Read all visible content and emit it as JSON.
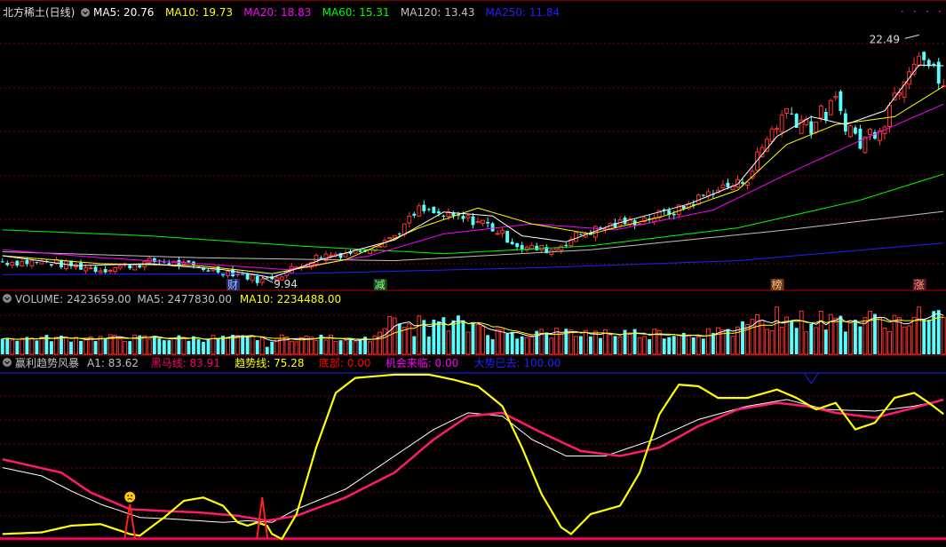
{
  "colors": {
    "bg": "#000000",
    "grid": "#7f0000",
    "up": "#ff3232",
    "down": "#54ffff",
    "ma5": "#ffffff",
    "ma10": "#ffff00",
    "ma20": "#ff00ff",
    "ma60": "#00ff00",
    "ma120": "#c0c0c0",
    "ma250": "#2020ff",
    "label": "#c0c0c0"
  },
  "price_panel": {
    "stock_name": "北方稀土",
    "period": "(日线)",
    "legend": [
      {
        "label": "MA5: 20.76",
        "color": "#ffffff"
      },
      {
        "label": "MA10: 19.73",
        "color": "#ffff00"
      },
      {
        "label": "MA20: 18.83",
        "color": "#ff00ff"
      },
      {
        "label": "MA60: 15.31",
        "color": "#00ff00"
      },
      {
        "label": "MA120: 13.43",
        "color": "#c0c0c0"
      },
      {
        "label": "MA250: 11.84",
        "color": "#2020ff"
      }
    ],
    "high_label": "22.49",
    "low_label": "9.94",
    "markers": [
      {
        "text": "财",
        "idx": 47
      },
      {
        "text": "减",
        "idx": 77
      },
      {
        "text": "榜",
        "idx": 158
      },
      {
        "text": "涨",
        "idx": 187
      }
    ]
  },
  "volume_panel": {
    "legend": [
      {
        "label": "VOLUME: 2423659.00",
        "color": "#c0c0c0"
      },
      {
        "label": "MA5: 2477830.00",
        "color": "#c0c0c0"
      },
      {
        "label": "MA10: 2234488.00",
        "color": "#ffff00"
      }
    ]
  },
  "indicator_panel": {
    "legend": [
      {
        "label": "赢利趋势风暴",
        "color": "#c0c0c0"
      },
      {
        "label": "A1: 83.62",
        "color": "#c0c0c0"
      },
      {
        "label": "黑马线: 83.91",
        "color": "#ff0064"
      },
      {
        "label": "趋势线: 75.28",
        "color": "#ffff00"
      },
      {
        "label": "底部: 0.00",
        "color": "#ff0000"
      },
      {
        "label": "机会来临: 0.00",
        "color": "#ff00ff"
      },
      {
        "label": "大势已去: 100.00",
        "color": "#2020ff"
      }
    ]
  },
  "chart_data": {
    "type": "candlestick",
    "y_range": [
      9.5,
      23.0
    ],
    "keypoints_close": [
      [
        0,
        10.9
      ],
      [
        10,
        10.85
      ],
      [
        20,
        10.5
      ],
      [
        32,
        10.95
      ],
      [
        40,
        10.6
      ],
      [
        48,
        10.3
      ],
      [
        53,
        9.94
      ],
      [
        58,
        10.4
      ],
      [
        65,
        11.2
      ],
      [
        72,
        11.4
      ],
      [
        80,
        12.2
      ],
      [
        85,
        13.5
      ],
      [
        90,
        13.2
      ],
      [
        98,
        12.9
      ],
      [
        106,
        11.6
      ],
      [
        112,
        11.5
      ],
      [
        118,
        12.3
      ],
      [
        124,
        12.7
      ],
      [
        130,
        13.0
      ],
      [
        138,
        13.5
      ],
      [
        145,
        14.5
      ],
      [
        150,
        14.8
      ],
      [
        153,
        15.6
      ],
      [
        157,
        17.6
      ],
      [
        160,
        18.5
      ],
      [
        165,
        17.8
      ],
      [
        170,
        18.8
      ],
      [
        175,
        16.8
      ],
      [
        180,
        18.2
      ],
      [
        184,
        20.5
      ],
      [
        187,
        21.8
      ],
      [
        190,
        20.3
      ],
      [
        192,
        19.8
      ]
    ],
    "keypoints_ma5": [
      [
        0,
        11.2
      ],
      [
        15,
        10.7
      ],
      [
        30,
        10.8
      ],
      [
        45,
        10.5
      ],
      [
        55,
        10.1
      ],
      [
        65,
        11.0
      ],
      [
        80,
        12.0
      ],
      [
        90,
        13.4
      ],
      [
        100,
        13.2
      ],
      [
        106,
        12.2
      ],
      [
        115,
        11.9
      ],
      [
        125,
        12.8
      ],
      [
        140,
        13.8
      ],
      [
        150,
        14.8
      ],
      [
        158,
        17.2
      ],
      [
        165,
        18.2
      ],
      [
        172,
        17.8
      ],
      [
        180,
        18.5
      ],
      [
        187,
        20.8
      ],
      [
        192,
        20.76
      ]
    ],
    "keypoints_ma10": [
      [
        0,
        11.2
      ],
      [
        20,
        10.8
      ],
      [
        40,
        10.7
      ],
      [
        55,
        10.3
      ],
      [
        70,
        11.0
      ],
      [
        85,
        12.6
      ],
      [
        97,
        13.6
      ],
      [
        108,
        12.8
      ],
      [
        120,
        12.3
      ],
      [
        135,
        13.2
      ],
      [
        150,
        14.5
      ],
      [
        160,
        16.8
      ],
      [
        170,
        17.8
      ],
      [
        182,
        18.2
      ],
      [
        192,
        19.73
      ]
    ],
    "keypoints_ma20": [
      [
        0,
        11.5
      ],
      [
        20,
        11.1
      ],
      [
        40,
        10.8
      ],
      [
        58,
        10.5
      ],
      [
        75,
        11.2
      ],
      [
        90,
        12.3
      ],
      [
        108,
        12.8
      ],
      [
        125,
        12.5
      ],
      [
        145,
        13.5
      ],
      [
        160,
        15.3
      ],
      [
        175,
        17.0
      ],
      [
        192,
        18.83
      ]
    ],
    "keypoints_ma60": [
      [
        0,
        12.5
      ],
      [
        30,
        12.2
      ],
      [
        60,
        11.7
      ],
      [
        90,
        11.3
      ],
      [
        120,
        11.7
      ],
      [
        150,
        12.6
      ],
      [
        175,
        14.0
      ],
      [
        192,
        15.31
      ]
    ],
    "keypoints_ma120": [
      [
        0,
        11.4
      ],
      [
        40,
        11.1
      ],
      [
        80,
        10.95
      ],
      [
        120,
        11.5
      ],
      [
        160,
        12.5
      ],
      [
        192,
        13.43
      ]
    ],
    "keypoints_ma250": [
      [
        0,
        10.25
      ],
      [
        60,
        10.3
      ],
      [
        110,
        10.6
      ],
      [
        150,
        10.95
      ],
      [
        192,
        11.84
      ]
    ],
    "volume_ma10_last": 2234488.0,
    "volume_ma5_last": 2477830.0,
    "indicator_range": [
      0,
      100
    ],
    "keypoints_trend": [
      [
        0,
        3
      ],
      [
        8,
        4
      ],
      [
        14,
        8
      ],
      [
        20,
        9
      ],
      [
        26,
        3
      ],
      [
        28,
        2
      ],
      [
        33,
        13
      ],
      [
        37,
        23
      ],
      [
        41,
        25
      ],
      [
        45,
        20
      ],
      [
        48,
        10
      ],
      [
        50,
        8
      ],
      [
        52,
        10
      ],
      [
        54,
        8
      ],
      [
        55,
        3
      ],
      [
        57,
        0
      ],
      [
        60,
        15
      ],
      [
        64,
        55
      ],
      [
        68,
        88
      ],
      [
        72,
        97
      ],
      [
        80,
        99
      ],
      [
        87,
        99
      ],
      [
        92,
        96
      ],
      [
        97,
        92
      ],
      [
        102,
        80
      ],
      [
        106,
        55
      ],
      [
        110,
        27
      ],
      [
        114,
        7
      ],
      [
        116,
        3
      ],
      [
        120,
        15
      ],
      [
        126,
        20
      ],
      [
        130,
        40
      ],
      [
        134,
        75
      ],
      [
        138,
        93
      ],
      [
        142,
        92
      ],
      [
        146,
        85
      ],
      [
        152,
        85
      ],
      [
        158,
        90
      ],
      [
        162,
        85
      ],
      [
        166,
        78
      ],
      [
        170,
        82
      ],
      [
        174,
        66
      ],
      [
        178,
        70
      ],
      [
        182,
        85
      ],
      [
        186,
        88
      ],
      [
        189,
        82
      ],
      [
        192,
        75.28
      ]
    ],
    "keypoints_heima": [
      [
        0,
        48
      ],
      [
        6,
        44
      ],
      [
        12,
        40
      ],
      [
        18,
        28
      ],
      [
        26,
        18
      ],
      [
        32,
        17
      ],
      [
        40,
        16
      ],
      [
        48,
        14
      ],
      [
        54,
        11
      ],
      [
        60,
        14
      ],
      [
        70,
        25
      ],
      [
        80,
        40
      ],
      [
        88,
        60
      ],
      [
        95,
        74
      ],
      [
        102,
        76
      ],
      [
        110,
        64
      ],
      [
        118,
        53
      ],
      [
        126,
        50
      ],
      [
        134,
        55
      ],
      [
        142,
        68
      ],
      [
        150,
        78
      ],
      [
        158,
        82
      ],
      [
        164,
        80
      ],
      [
        170,
        76
      ],
      [
        178,
        73
      ],
      [
        186,
        79
      ],
      [
        192,
        83.91
      ]
    ],
    "keypoints_a1": [
      [
        0,
        43
      ],
      [
        8,
        38
      ],
      [
        14,
        29
      ],
      [
        20,
        21
      ],
      [
        28,
        13
      ],
      [
        35,
        12
      ],
      [
        45,
        10
      ],
      [
        50,
        11
      ],
      [
        55,
        10
      ],
      [
        60,
        18
      ],
      [
        70,
        30
      ],
      [
        80,
        50
      ],
      [
        88,
        66
      ],
      [
        95,
        76
      ],
      [
        102,
        74
      ],
      [
        108,
        60
      ],
      [
        115,
        50
      ],
      [
        123,
        50
      ],
      [
        133,
        60
      ],
      [
        142,
        72
      ],
      [
        152,
        80
      ],
      [
        160,
        84
      ],
      [
        168,
        78
      ],
      [
        178,
        77
      ],
      [
        186,
        80
      ],
      [
        192,
        83.62
      ]
    ],
    "spikes": [
      {
        "idx": 26,
        "height": 21
      },
      {
        "idx": 53,
        "height": 25
      }
    ],
    "indicator_end_idx": 192
  }
}
